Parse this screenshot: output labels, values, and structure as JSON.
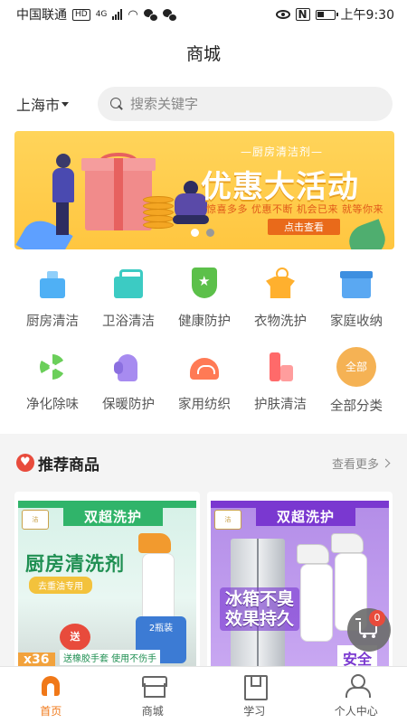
{
  "status_bar": {
    "carrier": "中国联通",
    "hd": "HD",
    "network": "4G",
    "time": "上午9:30",
    "nfc": "N"
  },
  "header": {
    "title": "商城"
  },
  "search": {
    "city": "上海市",
    "placeholder": "搜索关键字"
  },
  "banner": {
    "subtitle": "—厨房清洁剂—",
    "headline": "优惠大活动",
    "tagline": "惊喜多多 优惠不断 机会已来 就等你来",
    "cta": "点击查看",
    "page_count": 2,
    "active_page": 1,
    "colors": {
      "background": "#ffc640",
      "cta": "#e96a1a"
    }
  },
  "categories": [
    {
      "label": "厨房清洁",
      "icon": "kitchen-icon"
    },
    {
      "label": "卫浴清洁",
      "icon": "bathroom-icon"
    },
    {
      "label": "健康防护",
      "icon": "shield-icon"
    },
    {
      "label": "衣物洗护",
      "icon": "clothes-icon"
    },
    {
      "label": "家庭收纳",
      "icon": "storage-box-icon"
    },
    {
      "label": "净化除味",
      "icon": "fan-icon"
    },
    {
      "label": "保暖防护",
      "icon": "glove-icon"
    },
    {
      "label": "家用纺织",
      "icon": "blanket-icon"
    },
    {
      "label": "护肤清洁",
      "icon": "skincare-icon"
    },
    {
      "label": "全部分类",
      "icon": "all-categories-icon",
      "icon_text": "全部"
    }
  ],
  "recommend": {
    "title": "推荐商品",
    "more": "查看更多"
  },
  "products": [
    {
      "ribbon": "双超洗护",
      "title": "厨房清洗剂",
      "subtitle": "去重油专用",
      "gift": "送",
      "pack": "2瓶装",
      "count_tag": "x36",
      "footer": "送橡胶手套 使用不伤手",
      "accent": "#30b46a"
    },
    {
      "ribbon": "双超洗护",
      "title_line1": "冰箱不臭",
      "title_line2": "效果持久",
      "badge": "安全",
      "accent": "#7a38d0"
    }
  ],
  "cart": {
    "count": "0"
  },
  "tabs": [
    {
      "label": "首页",
      "icon": "home-icon",
      "active": true
    },
    {
      "label": "商城",
      "icon": "shop-icon",
      "active": false
    },
    {
      "label": "学习",
      "icon": "book-icon",
      "active": false
    },
    {
      "label": "个人中心",
      "icon": "user-icon",
      "active": false
    }
  ],
  "colors": {
    "accent": "#f07818",
    "heart": "#e84b3c"
  }
}
